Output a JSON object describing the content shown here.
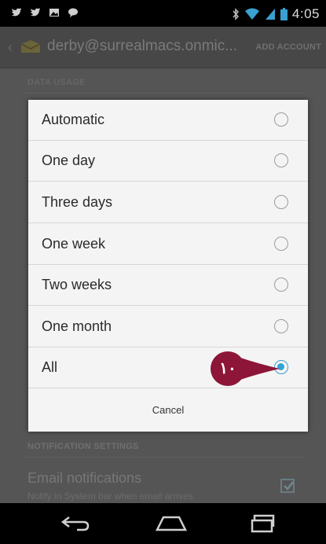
{
  "status_bar": {
    "time": "4:05",
    "left_icons": [
      "twitter-icon",
      "twitter-icon",
      "gallery-icon",
      "chat-icon"
    ],
    "right_icons": [
      "bluetooth-icon",
      "wifi-icon",
      "signal-icon",
      "battery-icon"
    ]
  },
  "action_bar": {
    "account": "derby@surrealmacs.onmic...",
    "add_account": "ADD ACCOUNT"
  },
  "settings": {
    "data_usage_header": "DATA USAGE",
    "notification_header": "NOTIFICATION SETTINGS",
    "email_notifications_title": "Email notifications",
    "email_notifications_summary": "Notify in System bar when email arrives",
    "email_notifications_checked": true
  },
  "dialog": {
    "options": [
      {
        "label": "Automatic",
        "selected": false
      },
      {
        "label": "One day",
        "selected": false
      },
      {
        "label": "Three days",
        "selected": false
      },
      {
        "label": "One week",
        "selected": false
      },
      {
        "label": "Two weeks",
        "selected": false
      },
      {
        "label": "One month",
        "selected": false
      },
      {
        "label": "All",
        "selected": true
      }
    ],
    "cancel": "Cancel"
  },
  "callout": {
    "number": "١٠",
    "color": "#8c1538"
  },
  "colors": {
    "accent": "#33a3d6",
    "dialog_bg": "#f4f4f4",
    "scrim": "#555555"
  },
  "nav_bar": {
    "buttons": [
      "back-icon",
      "home-icon",
      "recents-icon"
    ]
  }
}
